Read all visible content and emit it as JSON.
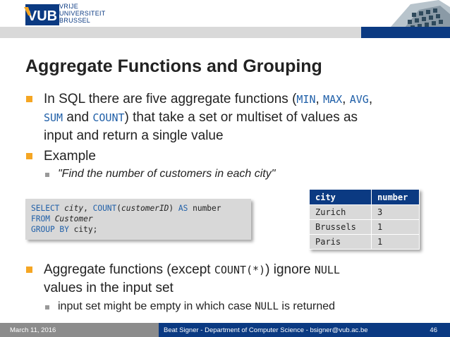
{
  "header": {
    "logo": "VUB",
    "university_lines": [
      "VRIJE",
      "UNIVERSITEIT",
      "BRUSSEL"
    ]
  },
  "title": "Aggregate Functions and Grouping",
  "bullet1": {
    "p1": "In SQL there are five aggregate functions (",
    "f1": "MIN",
    "s1": ", ",
    "f2": "MAX",
    "s2": ", ",
    "f3": "AVG",
    "s3": ",",
    "f4": "SUM",
    "s4": " and ",
    "f5": "COUNT",
    "p2": ") that take a set or multiset of values as",
    "p3": "input and return a single value"
  },
  "bullet2": {
    "label": "Example",
    "sub": "\"Find the number of customers in each city\""
  },
  "sql": {
    "l1_a": "SELECT ",
    "l1_b": "city",
    "l1_c": ", ",
    "l1_d": "COUNT",
    "l1_e": "(",
    "l1_f": "customerID",
    "l1_g": ") ",
    "l1_h": "AS",
    "l1_i": " number",
    "l2_a": "FROM ",
    "l2_b": "Customer",
    "l3_a": "GROUP BY",
    "l3_b": " city;"
  },
  "result_table": {
    "headers": [
      "city",
      "number"
    ],
    "rows": [
      [
        "Zurich",
        "3"
      ],
      [
        "Brussels",
        "1"
      ],
      [
        "Paris",
        "1"
      ]
    ]
  },
  "bullet3": {
    "p1": "Aggregate functions (except ",
    "c1": "COUNT(*)",
    "p2": ") ignore ",
    "c2": "NULL",
    "p3": "values in the input set",
    "sub_a": "input set might be empty in which case ",
    "sub_c": "NULL",
    "sub_b": " is returned"
  },
  "footer": {
    "date": "March 11, 2016",
    "center": "Beat Signer - Department of Computer Science - bsigner@vub.ac.be",
    "page": "46"
  },
  "colors": {
    "brand_blue": "#0b3a82",
    "bullet_orange": "#f5a623",
    "keyword_blue": "#1f5fa8"
  }
}
